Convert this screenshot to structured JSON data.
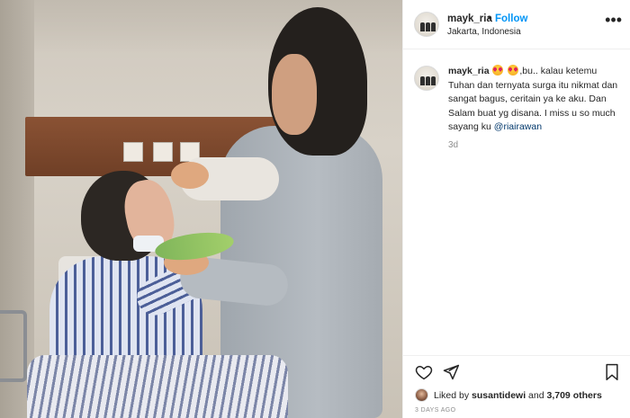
{
  "post": {
    "username": "mayk_ria",
    "separator": "•",
    "follow_label": "Follow",
    "location": "Jakarta, Indonesia",
    "more_icon": "more-horizontal-icon",
    "more_glyph": "•••"
  },
  "caption": {
    "username": "mayk_ria",
    "emoji": "smiling-face-with-heart-eyes",
    "text_part1": ",bu.. kalau ketemu Tuhan dan ternyata surga itu nikmat dan sangat bagus, ceritain ya ke aku. Dan Salam buat yg disana. I miss u so much sayang ku ",
    "mention": "@riairawan",
    "time": "3d"
  },
  "actions": {
    "like_icon": "heart-icon",
    "share_icon": "send-icon",
    "save_icon": "bookmark-icon"
  },
  "likes": {
    "prefix": "Liked by ",
    "liker": "susantidewi",
    "middle": " and ",
    "count": "3,709 others"
  },
  "posted_ago": "3 DAYS AGO",
  "colors": {
    "link_blue": "#0095f6",
    "mention": "#00376b",
    "muted": "#8e8e8e",
    "text": "#262626",
    "border": "#efefef"
  }
}
